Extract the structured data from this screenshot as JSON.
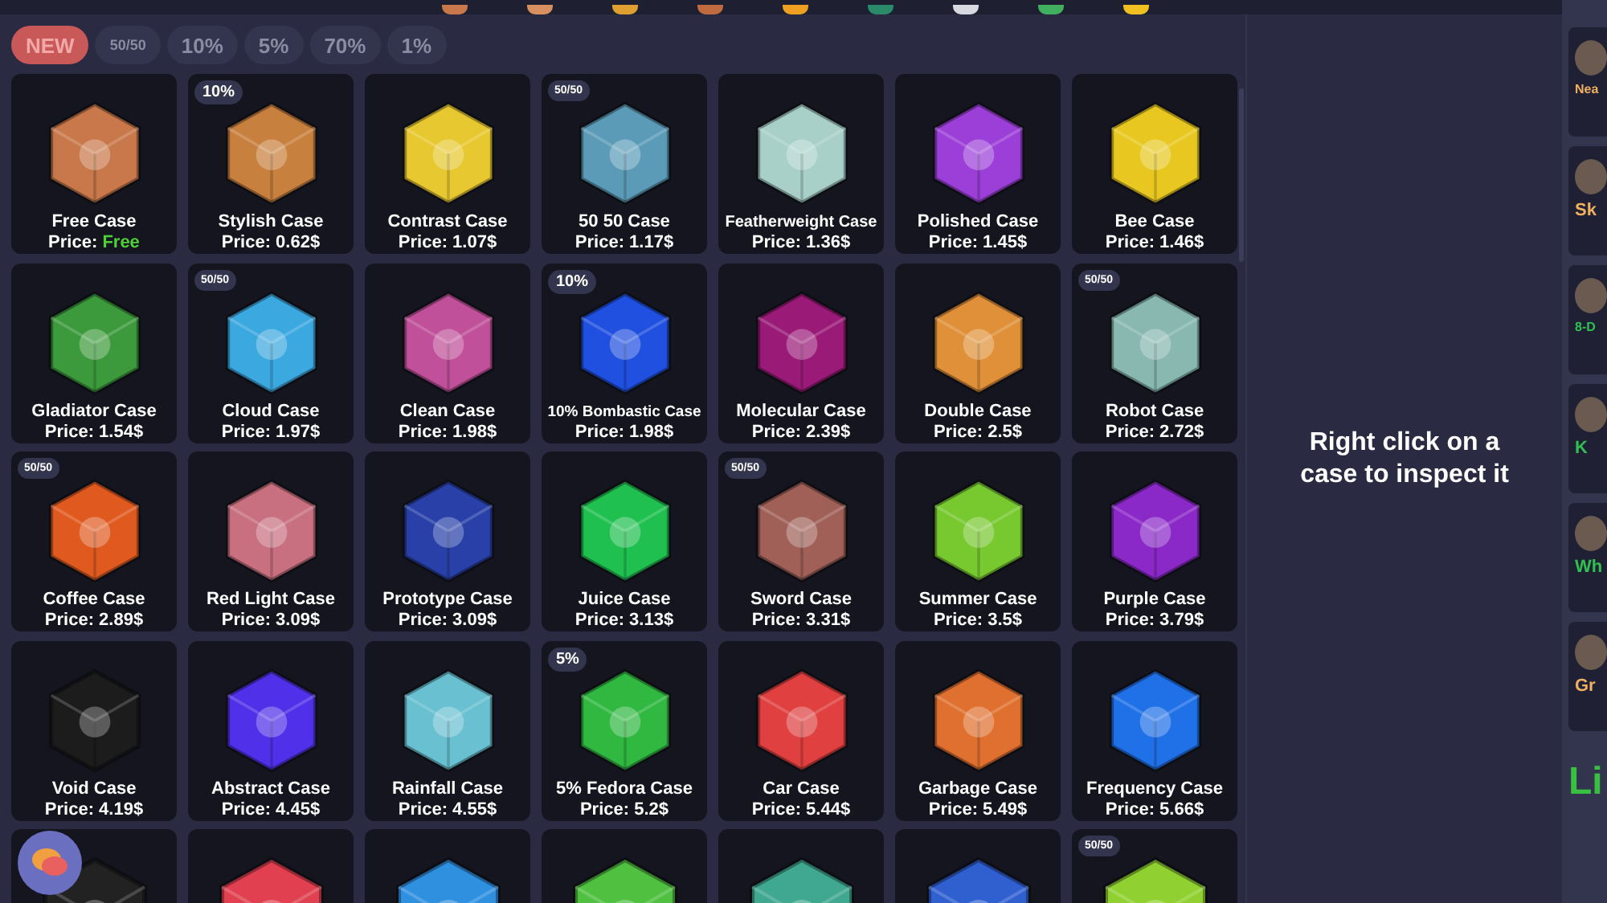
{
  "top_strip": {
    "items": [
      {
        "color": "#c8784a"
      },
      {
        "color": "#d89060"
      },
      {
        "color": "#e0a030"
      },
      {
        "color": "#c06a40"
      },
      {
        "color": "#f0a020"
      },
      {
        "color": "#2a8a6a"
      },
      {
        "color": "#d8d8e0"
      },
      {
        "color": "#40b060"
      },
      {
        "color": "#f0c020"
      }
    ]
  },
  "filters": [
    {
      "label": "NEW",
      "selected": true
    },
    {
      "label": "50/50",
      "selected": false
    },
    {
      "label": "10%",
      "selected": false
    },
    {
      "label": "5%",
      "selected": false
    },
    {
      "label": "70%",
      "selected": false
    },
    {
      "label": "1%",
      "selected": false
    }
  ],
  "cases": [
    {
      "name": "Free Case",
      "price_label": "Price:",
      "price": "Free",
      "price_highlight": true,
      "color": "#c8784a"
    },
    {
      "name": "Stylish Case",
      "price_label": "Price:",
      "price": "0.62$",
      "price_highlight": false,
      "color": "#c8803e",
      "badge": "10%"
    },
    {
      "name": "Contrast Case",
      "price_label": "Price:",
      "price": "1.07$",
      "price_highlight": false,
      "color": "#e8c830"
    },
    {
      "name": "50 50 Case",
      "price_label": "Price:",
      "price": "1.17$",
      "price_highlight": false,
      "color": "#5c9bb8",
      "badge": "50/50"
    },
    {
      "name": "Featherweight Case",
      "price_label": "Price:",
      "price": "1.36$",
      "price_highlight": false,
      "color": "#a8d0c8"
    },
    {
      "name": "Polished Case",
      "price_label": "Price:",
      "price": "1.45$",
      "price_highlight": false,
      "color": "#9b3fd8"
    },
    {
      "name": "Bee Case",
      "price_label": "Price:",
      "price": "1.46$",
      "price_highlight": false,
      "color": "#e8c820"
    },
    {
      "name": "Gladiator Case",
      "price_label": "Price:",
      "price": "1.54$",
      "price_highlight": false,
      "color": "#3c9a3c"
    },
    {
      "name": "Cloud Case",
      "price_label": "Price:",
      "price": "1.97$",
      "price_highlight": false,
      "color": "#3ca8e0",
      "badge": "50/50"
    },
    {
      "name": "Clean Case",
      "price_label": "Price:",
      "price": "1.98$",
      "price_highlight": false,
      "color": "#c0509a"
    },
    {
      "name": "10% Bombastic Case",
      "price_label": "Price:",
      "price": "1.98$",
      "price_highlight": false,
      "color": "#2050e0",
      "badge": "10%"
    },
    {
      "name": "Molecular Case",
      "price_label": "Price:",
      "price": "2.39$",
      "price_highlight": false,
      "color": "#9a1a78"
    },
    {
      "name": "Double Case",
      "price_label": "Price:",
      "price": "2.5$",
      "price_highlight": false,
      "color": "#e09038"
    },
    {
      "name": "Robot Case",
      "price_label": "Price:",
      "price": "2.72$",
      "price_highlight": false,
      "color": "#88b8b0",
      "badge": "50/50"
    },
    {
      "name": "Coffee Case",
      "price_label": "Price:",
      "price": "2.89$",
      "price_highlight": false,
      "color": "#e05a20",
      "badge": "50/50"
    },
    {
      "name": "Red Light Case",
      "price_label": "Price:",
      "price": "3.09$",
      "price_highlight": false,
      "color": "#c87080"
    },
    {
      "name": "Prototype Case",
      "price_label": "Price:",
      "price": "3.09$",
      "price_highlight": false,
      "color": "#2840a8"
    },
    {
      "name": "Juice Case",
      "price_label": "Price:",
      "price": "3.13$",
      "price_highlight": false,
      "color": "#20c050"
    },
    {
      "name": "Sword Case",
      "price_label": "Price:",
      "price": "3.31$",
      "price_highlight": false,
      "color": "#a06058",
      "badge": "50/50"
    },
    {
      "name": "Summer Case",
      "price_label": "Price:",
      "price": "3.5$",
      "price_highlight": false,
      "color": "#78c830"
    },
    {
      "name": "Purple Case",
      "price_label": "Price:",
      "price": "3.79$",
      "price_highlight": false,
      "color": "#8a28c8"
    },
    {
      "name": "Void Case",
      "price_label": "Price:",
      "price": "4.19$",
      "price_highlight": false,
      "color": "#1c1c1c"
    },
    {
      "name": "Abstract Case",
      "price_label": "Price:",
      "price": "4.45$",
      "price_highlight": false,
      "color": "#5030e8"
    },
    {
      "name": "Rainfall Case",
      "price_label": "Price:",
      "price": "4.55$",
      "price_highlight": false,
      "color": "#68c0d0"
    },
    {
      "name": "5% Fedora Case",
      "price_label": "Price:",
      "price": "5.2$",
      "price_highlight": false,
      "color": "#30b840",
      "badge": "5%"
    },
    {
      "name": "Car Case",
      "price_label": "Price:",
      "price": "5.44$",
      "price_highlight": false,
      "color": "#e04040"
    },
    {
      "name": "Garbage Case",
      "price_label": "Price:",
      "price": "5.49$",
      "price_highlight": false,
      "color": "#e07030"
    },
    {
      "name": "Frequency Case",
      "price_label": "Price:",
      "price": "5.66$",
      "price_highlight": false,
      "color": "#2070e8"
    },
    {
      "color": "#222222"
    },
    {
      "color": "#e04050"
    },
    {
      "color": "#3090e0"
    },
    {
      "color": "#50c040"
    },
    {
      "color": "#40a890"
    },
    {
      "color": "#3060d0"
    },
    {
      "color": "#90d030",
      "badge": "50/50"
    }
  ],
  "inspect_hint": "Right click on a case to inspect it",
  "sidebar": [
    {
      "name": "Nea",
      "color": "#f0b060"
    },
    {
      "name": "Sk",
      "color": "#f0b060"
    },
    {
      "name": "8-D",
      "color": "#30c050"
    },
    {
      "name": "K",
      "color": "#30c050"
    },
    {
      "name": "Wh",
      "color": "#30c050"
    },
    {
      "name": "Gr",
      "color": "#f0b060"
    }
  ],
  "sidebar_footer": "Li"
}
